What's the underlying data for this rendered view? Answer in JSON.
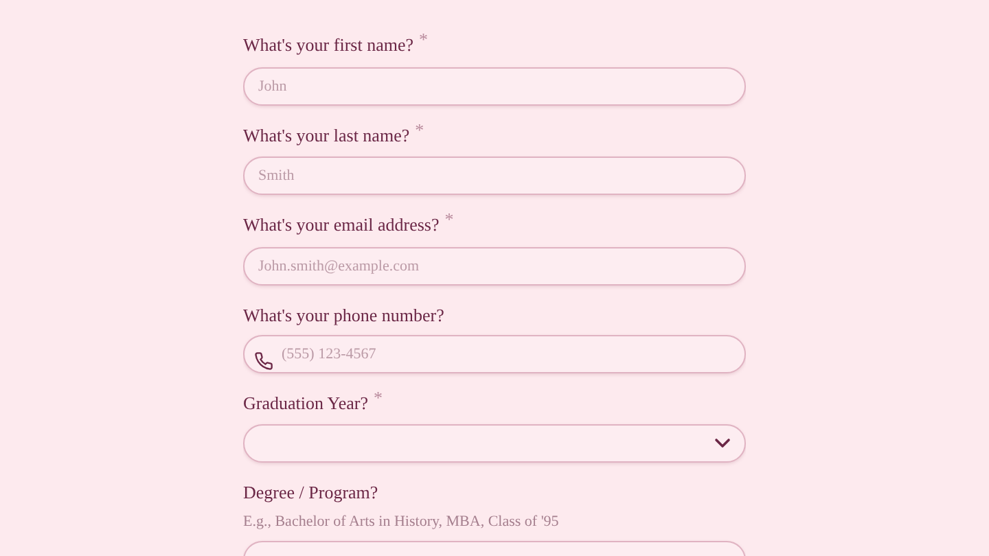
{
  "fields": [
    {
      "kind": "text",
      "label": "What's your first name?",
      "required_mark": "*",
      "placeholder": "John"
    },
    {
      "kind": "text",
      "label": "What's your last name?",
      "required_mark": "*",
      "placeholder": "Smith"
    },
    {
      "kind": "text",
      "label": "What's your email address?",
      "required_mark": "*",
      "placeholder": "John.smith@example.com"
    },
    {
      "kind": "phone",
      "label": "What's your phone number?",
      "placeholder": "(555) 123-4567"
    },
    {
      "kind": "select",
      "label": "Graduation Year?",
      "required_mark": "*"
    },
    {
      "kind": "text",
      "label": "Degree / Program?",
      "hint": "E.g., Bachelor of Arts in History, MBA, Class of '95"
    }
  ]
}
